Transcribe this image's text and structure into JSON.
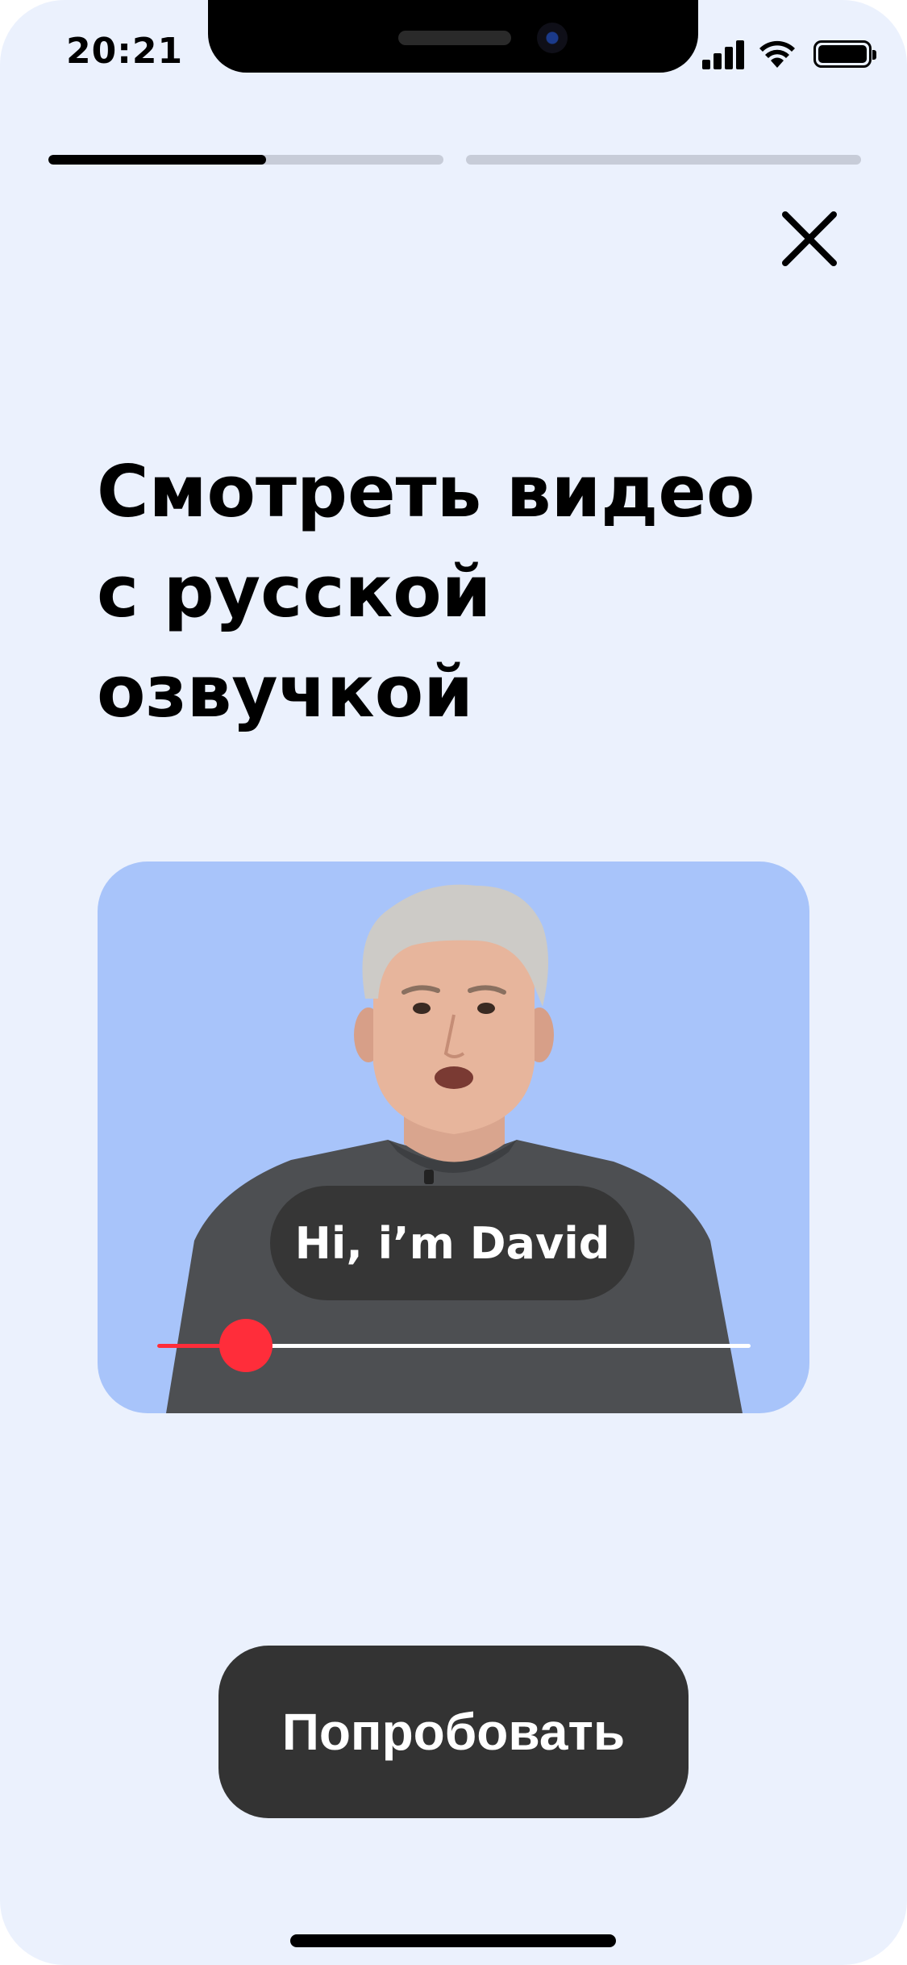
{
  "status_bar": {
    "time": "20:21",
    "icons": [
      "cellular-signal-icon",
      "wifi-icon",
      "battery-icon"
    ]
  },
  "progress": {
    "segments": [
      {
        "fill": 0.55
      },
      {
        "fill": 0
      }
    ]
  },
  "close_icon": "close-icon",
  "title": {
    "line1": "Смотреть видео",
    "line2": "с русской озвучкой"
  },
  "video": {
    "subtitle": "Hi, i’m David",
    "playback_progress": 0.15
  },
  "cta": {
    "label": "Попробовать"
  },
  "colors": {
    "background": "#ebf1fd",
    "video_background": "#a8c4fa",
    "scrubber_accent": "#ff2d3a",
    "cta_background": "#333333"
  }
}
